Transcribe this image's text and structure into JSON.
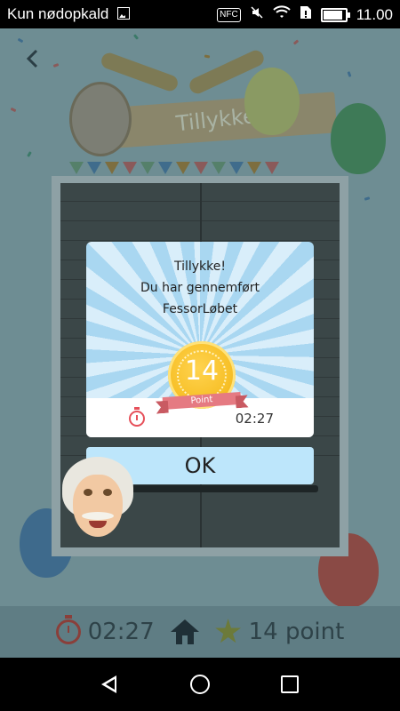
{
  "status_bar": {
    "carrier": "Kun nødopkald",
    "nfc_label": "NFC",
    "time": "11.00",
    "icons": [
      "image-icon",
      "nfc-icon",
      "mute-icon",
      "wifi-icon",
      "sim-icon",
      "battery-icon"
    ]
  },
  "background": {
    "banner_title": "Tillykke"
  },
  "dialog": {
    "line1": "Tillykke!",
    "line2": "Du har gennemført",
    "line3": "FessorLøbet",
    "medal_points": "14",
    "medal_label": "Point",
    "time": "02:27",
    "ok_label": "OK"
  },
  "bottom_bar": {
    "time": "02:27",
    "points": "14 point"
  },
  "colors": {
    "dialog_ray_light": "#d9eefa",
    "dialog_ray_dark": "#a9d7f1",
    "ok_button": "#bde6fb",
    "medal": "#f7c028",
    "ribbon": "#e57a82",
    "timer_red": "#e6505a"
  }
}
